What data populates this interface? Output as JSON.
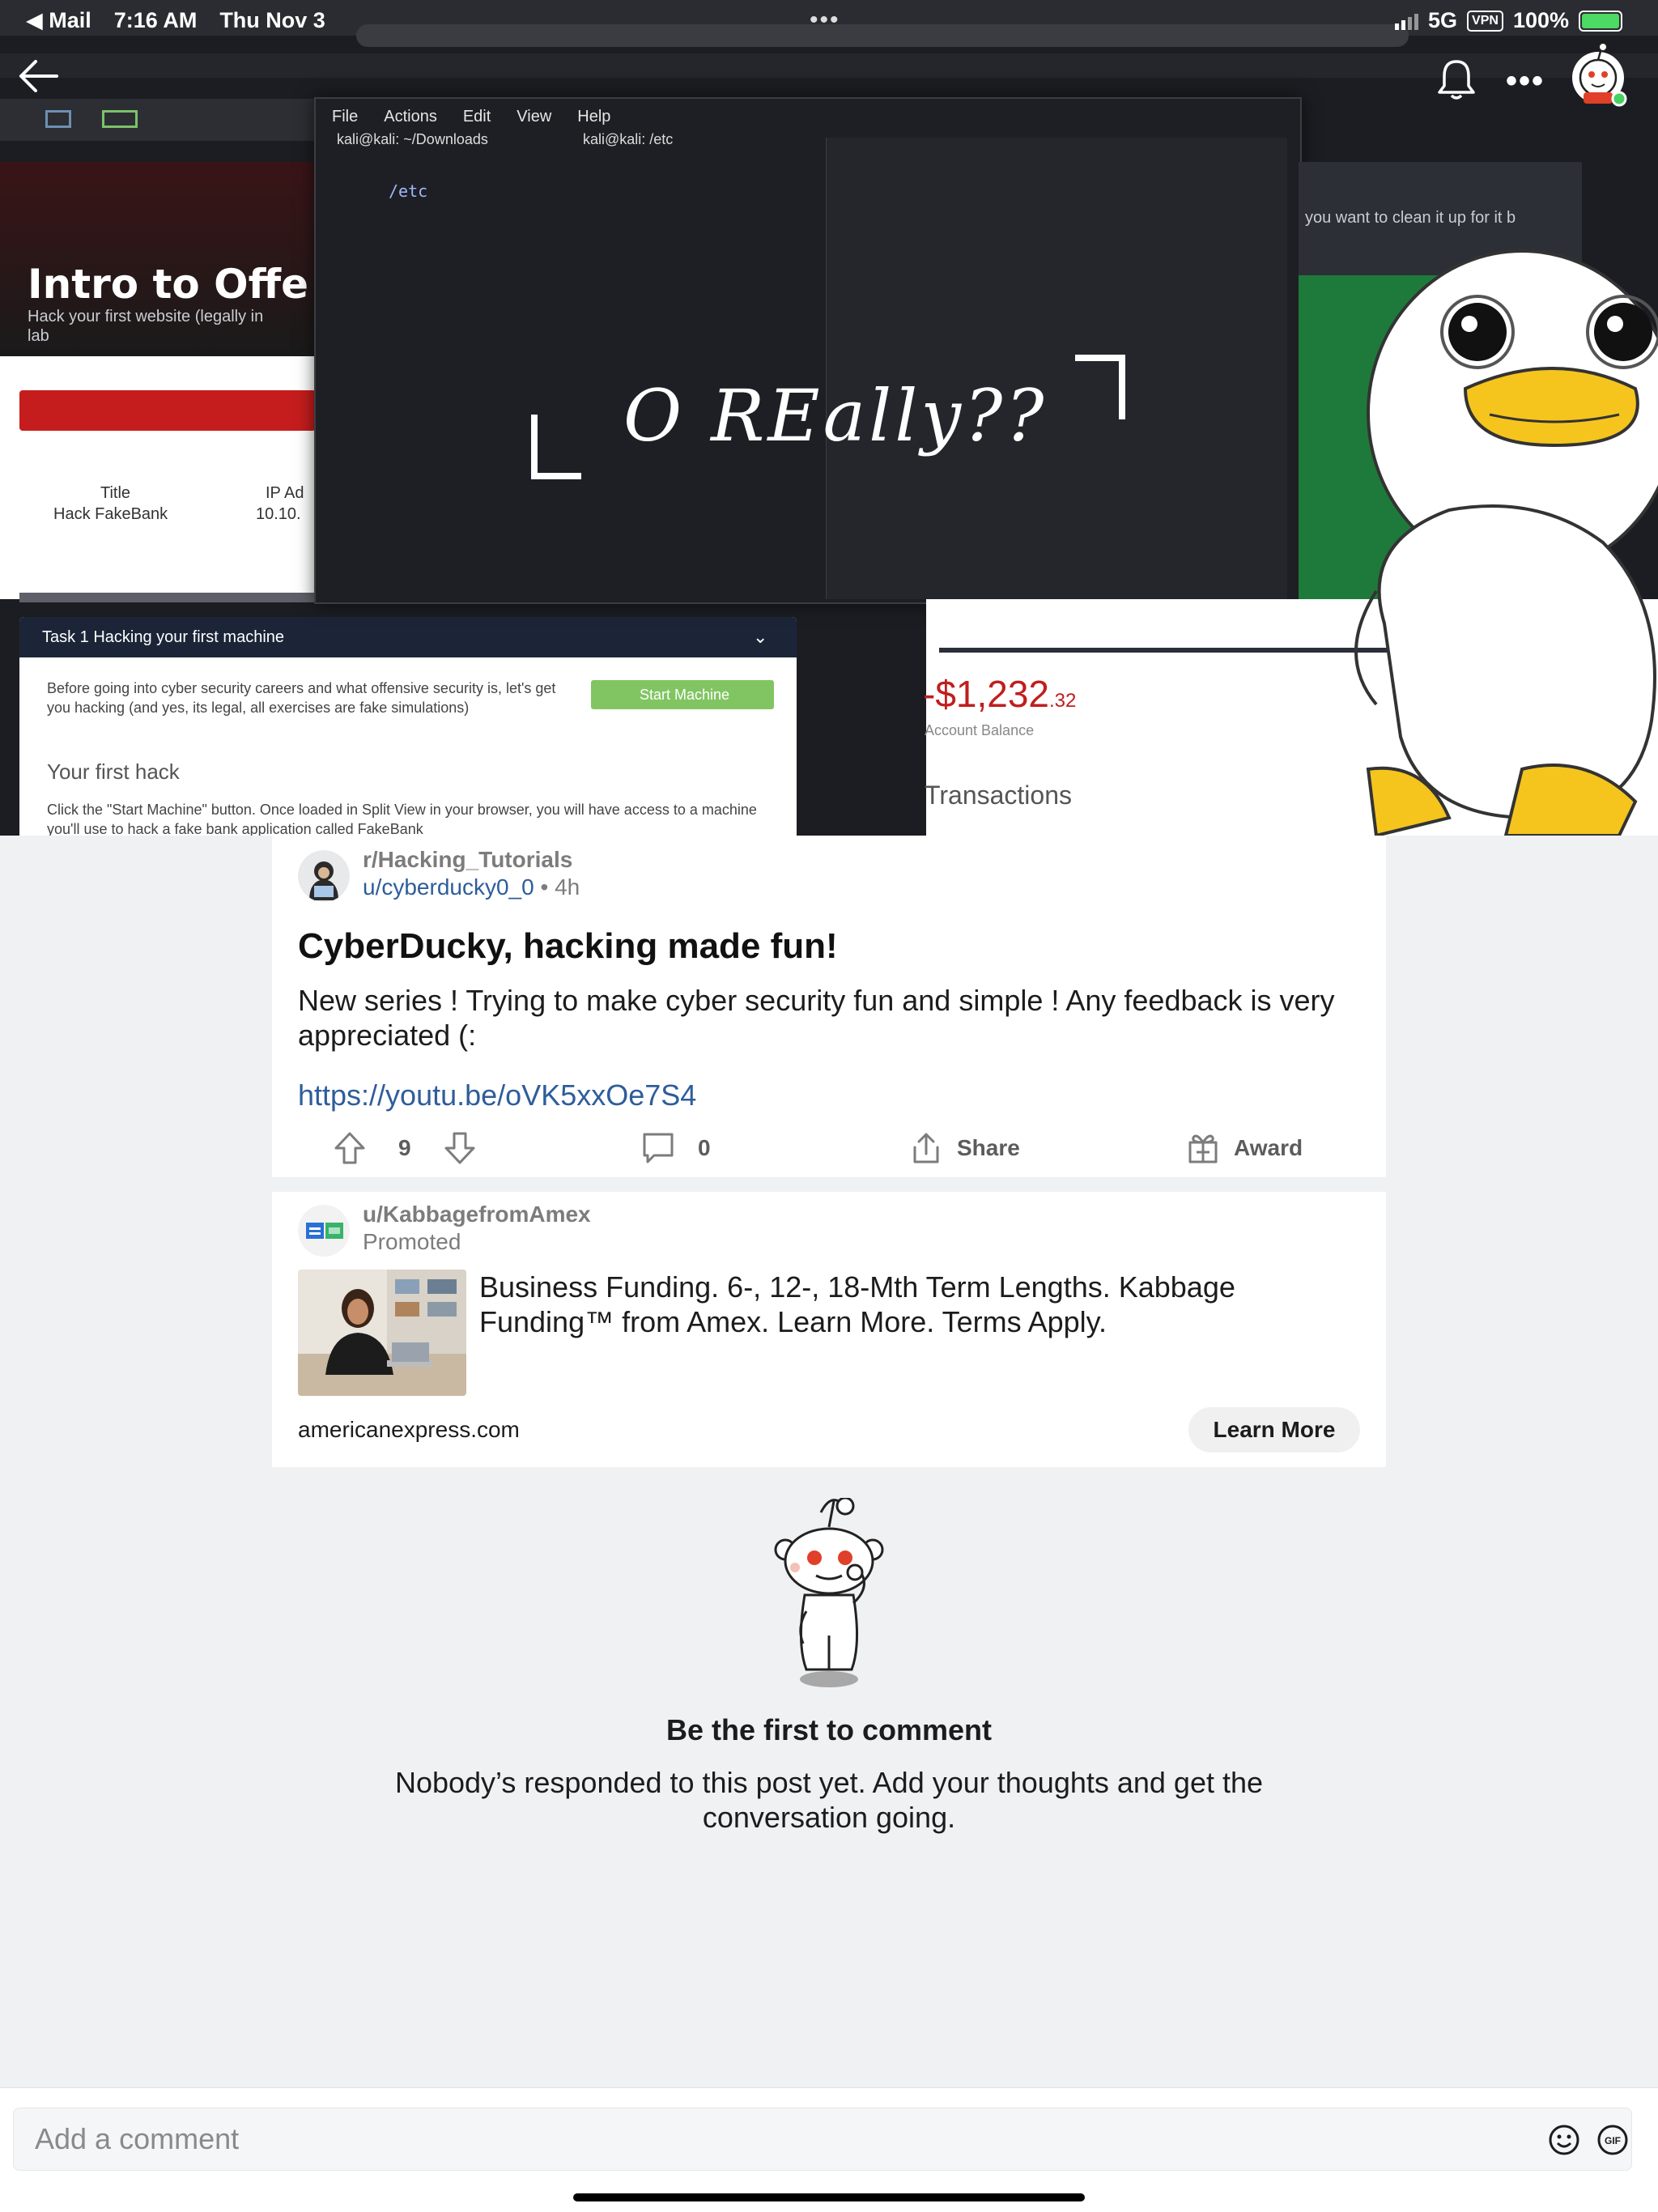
{
  "status_bar": {
    "back_app": "◀ Mail",
    "time": "7:16 AM",
    "date": "Thu Nov 3",
    "network": "5G",
    "vpn": "VPN",
    "battery": "100%"
  },
  "hero": {
    "video_caption": "O REally??",
    "course_title": "Intro to Offe",
    "course_sub": "Hack your first website (legally in",
    "course_sub2": "lab",
    "terminal_menu": [
      "File",
      "Actions",
      "Edit",
      "View",
      "Help"
    ],
    "terminal_tab1": "kali@kali: ~/Downloads",
    "terminal_tab2": "kali@kali: /etc",
    "terminal_prompt": "/etc",
    "table_title": "Title",
    "table_title_val": "Hack FakeBank",
    "table_ip": "IP Ad",
    "table_ip_val": "10.10.",
    "task_header": "Task 1 Hacking your first machine",
    "task_body": "Before going into cyber security careers and what offensive security is, let's get you hacking (and yes, its legal, all exercises are fake simulations)",
    "task_subhead": "Your first hack",
    "task_body2": "Click the \"Start Machine\" button. Once loaded in Split View in your browser, you will have access to a machine you'll use to hack a fake bank application called FakeBank",
    "start_btn": "Start Machine",
    "balance": "-$1,232",
    "balance_cents": ".32",
    "balance_label": "Account Balance",
    "transactions": "Transactions",
    "popup_text": "you want to clean it up for it back"
  },
  "post": {
    "subreddit": "r/Hacking_Tutorials",
    "author": "u/cyberducky0_0",
    "separator": " • ",
    "age": "4h",
    "title": "CyberDucky, hacking made fun!",
    "body": "New series ! Trying to make cyber security fun and simple ! Any feedback is very appreciated (:",
    "link": "https://youtu.be/oVK5xxOe7S4",
    "score": "9",
    "comments": "0",
    "share_label": "Share",
    "award_label": "Award"
  },
  "ad": {
    "author": "u/KabbagefromAmex",
    "promoted_label": "Promoted",
    "headline": "Business Funding. 6-, 12-, 18-Mth Term Lengths. Kabbage Funding™ from Amex. Learn More. Terms Apply.",
    "domain": "americanexpress.com",
    "cta": "Learn More"
  },
  "empty_state": {
    "title": "Be the first to comment",
    "message": "Nobody’s responded to this post yet. Add your thoughts and get the conversation going."
  },
  "comment_bar": {
    "placeholder": "Add a comment"
  },
  "colors": {
    "link": "#2e5d9a",
    "meta": "#7c7c7c",
    "page_bg": "#eff1f3",
    "online_dot": "#46d160"
  },
  "icons": [
    "back-arrow-icon",
    "bell-icon",
    "more-icon",
    "avatar-icon",
    "upvote-icon",
    "downvote-icon",
    "comment-icon",
    "share-icon",
    "award-icon",
    "emoji-icon",
    "gif-icon",
    "snoo-mascot"
  ]
}
